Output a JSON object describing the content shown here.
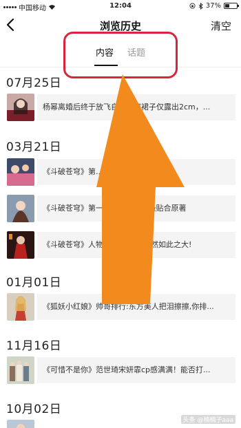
{
  "status_bar": {
    "carrier": "中国移动",
    "time": "12:04",
    "battery": "37%",
    "battery_level": 0.37
  },
  "header": {
    "title": "浏览历史",
    "clear_label": "清空"
  },
  "tabs": [
    {
      "label": "内容",
      "active": true
    },
    {
      "label": "话题",
      "active": false
    }
  ],
  "history": [
    {
      "date": "07月25日",
      "items": [
        {
          "text": "杨幂离婚后终于放飞自我，穿裙子仅露出2cm，..."
        }
      ]
    },
    {
      "date": "03月21日",
      "items": [
        {
          "text": "《斗破苍穹》第...可方物,完爆《..."
        },
        {
          "text": "《斗破苍穹》第一季...花哪一个最贴合原著"
        },
        {
          "text": "《斗破苍穹》人物仅...出,差距竟然如此之大!"
        }
      ]
    },
    {
      "date": "01月01日",
      "items": [
        {
          "text": "《狐妖小红娘》帅哥排行:东方美人把泪擦擦,你排..."
        }
      ]
    },
    {
      "date": "11月16日",
      "items": [
        {
          "text": "《可惜不是你》范世琦宋妍霏cp感满满！能否打..."
        }
      ]
    },
    {
      "date": "10月02日",
      "items": []
    }
  ],
  "watermark": "头条 @楠楠子aaa",
  "colors": {
    "annotation_red": "#d8253a",
    "arrow_orange": "#f28a1e",
    "item_bg": "#f4f4f4",
    "inactive_tab": "#999999"
  }
}
